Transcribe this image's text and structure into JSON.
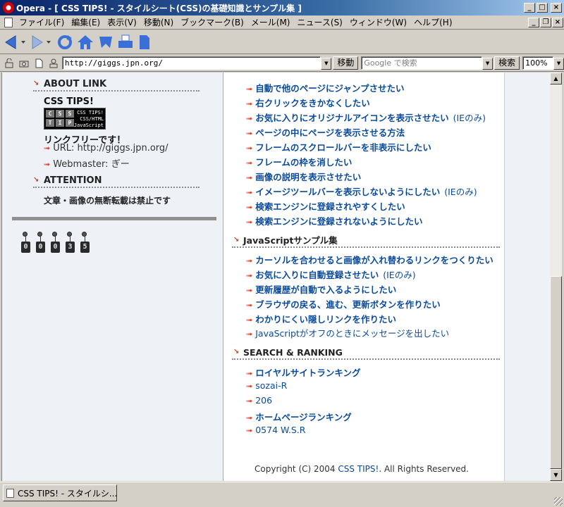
{
  "window": {
    "title": "Opera - [ CSS TIPS! - スタイルシート(CSS)の基礎知識とサンプル集 ]",
    "minimize": "_",
    "maximize": "□",
    "close": "×"
  },
  "menubar": {
    "items": [
      "ファイル(F)",
      "編集(E)",
      "表示(V)",
      "移動(N)",
      "ブックマーク(B)",
      "メール(M)",
      "ニュース(S)",
      "ウィンドウ(W)",
      "ヘルプ(H)"
    ],
    "doc_min": "_",
    "doc_restore": "❐",
    "doc_close": "×"
  },
  "addressbar": {
    "url": "http://giggs.jpn.org/",
    "go_label": "移動",
    "search_placeholder": "Google で検索",
    "search_label": "検索",
    "zoom": "100%"
  },
  "left": {
    "about_heading": "ABOUT LINK",
    "site_name": "CSS TIPS!",
    "banner_letters": [
      "C",
      "S",
      "S",
      "T",
      "I",
      "P"
    ],
    "banner_lines": [
      "CSS TIPS!",
      "CSS/HTML",
      "JavaScript"
    ],
    "link_free": "リンクフリーです！",
    "url_line": "URL: http://giggs.jpn.org/",
    "webmaster_line": "Webmaster: ぎー",
    "attention_heading": "ATTENTION",
    "attention_text": "文章・画像の無断転載は禁止です",
    "counter": [
      "0",
      "0",
      "0",
      "3",
      "5"
    ]
  },
  "right": {
    "html_links": [
      {
        "text": "自動で他のページにジャンプさせたい",
        "note": ""
      },
      {
        "text": "右クリックをきかなくしたい",
        "note": ""
      },
      {
        "text": "お気に入りにオリジナルアイコンを表示させたい",
        "note": "(IEのみ)"
      },
      {
        "text": "ページの中にページを表示させる方法",
        "note": ""
      },
      {
        "text": "フレームのスクロールバーを非表示にしたい",
        "note": ""
      },
      {
        "text": "フレームの枠を消したい",
        "note": ""
      },
      {
        "text": "画像の説明を表示させたい",
        "note": ""
      },
      {
        "text": "イメージツールバーを表示しないようにしたい",
        "note": "(IEのみ)"
      },
      {
        "text": "検索エンジンに登録されやすくしたい",
        "note": ""
      },
      {
        "text": "検索エンジンに登録されないようにしたい",
        "note": ""
      }
    ],
    "js_heading": "JavaScriptサンプル集",
    "js_links": [
      {
        "text": "カーソルを合わせると画像が入れ替わるリンクをつくりたい",
        "note": ""
      },
      {
        "text": "お気に入りに自動登録させたい",
        "note": "(IEのみ)"
      },
      {
        "text": "更新履歴が自動で入るようにしたい",
        "note": ""
      },
      {
        "text": "ブラウザの戻る、進む、更新ボタンを作りたい",
        "note": ""
      },
      {
        "text": "わかりにくい隠しリンクを作りたい",
        "note": ""
      },
      {
        "text": "JavaScriptがオフのときにメッセージを出したい",
        "note": ""
      }
    ],
    "ranking_heading": "SEARCH & RANKING",
    "ranking_links": [
      {
        "text": "ロイヤルサイトランキング",
        "bold": true
      },
      {
        "text": "sozai-R",
        "bold": false
      },
      {
        "text": "206",
        "bold": false
      },
      {
        "text": "ホームページランキング",
        "bold": true
      },
      {
        "text": "0574 W.S.R",
        "bold": false
      }
    ],
    "copyright_prefix": "Copyright (C) 2004 ",
    "copyright_site": "CSS TIPS!",
    "copyright_suffix": ". All Rights Reserved."
  },
  "statusbar": {
    "tab_label": "CSS TIPS! - スタイルシ..."
  },
  "colors": {
    "link": "#0a4a9c",
    "arrow": "#e04020",
    "titlebar": "#0a246a"
  }
}
